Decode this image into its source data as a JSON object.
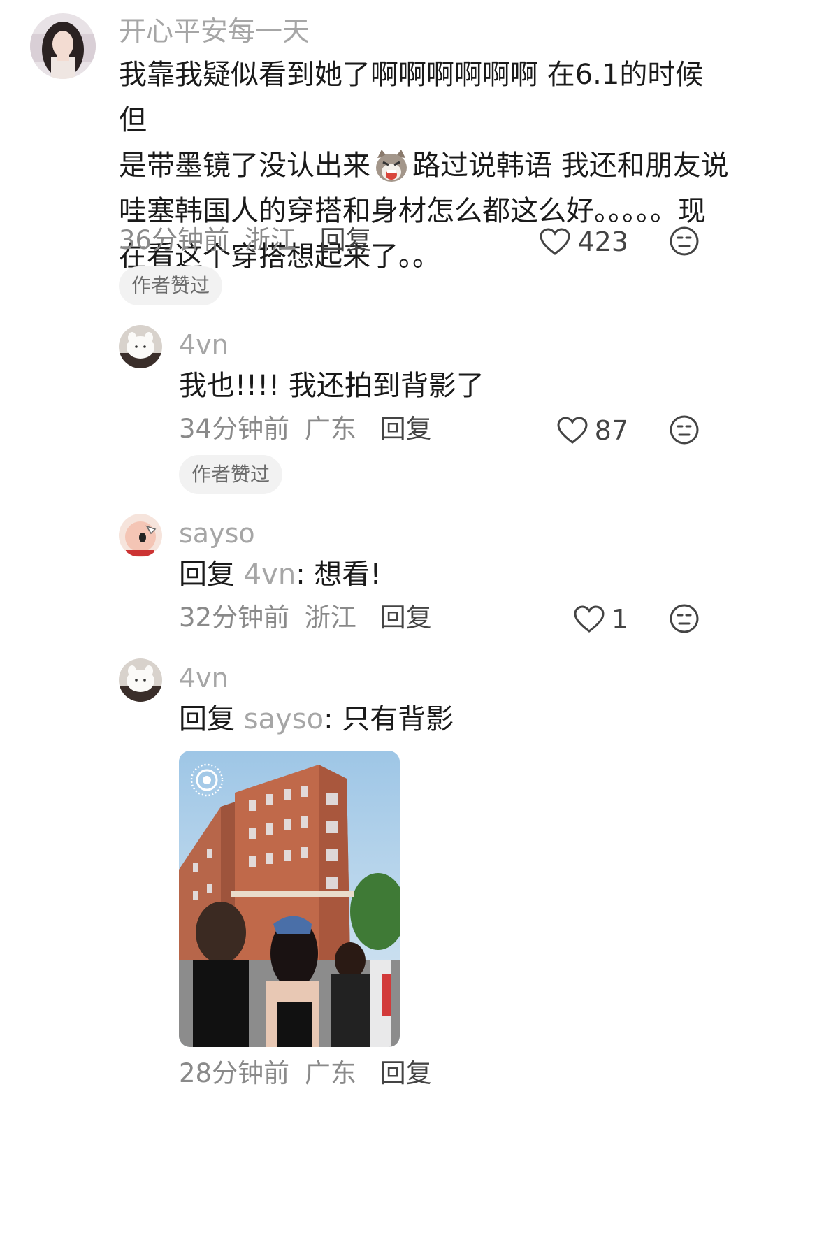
{
  "comments": [
    {
      "username": "开心平安每一天",
      "text_lines": [
        "我靠我疑似看到她了啊啊啊啊啊啊  在6.1的时候 但",
        "是带墨镜了没认出来",
        " 路过说韩语 我还和朋友说",
        "哇塞韩国人的穿搭和身材怎么都这么好。。。。。现",
        "在看这个穿搭想起来了。。"
      ],
      "time": "36分钟前",
      "location": "浙江",
      "reply_label": "回复",
      "likes": "423",
      "badge": "作者赞过"
    },
    {
      "username": "4vn",
      "text": "我也!!!!  我还拍到背影了",
      "time": "34分钟前",
      "location": "广东",
      "reply_label": "回复",
      "likes": "87",
      "badge": "作者赞过"
    },
    {
      "username": "sayso",
      "reply_prefix": "回复",
      "reply_to": "4vn",
      "text": ": 想看!",
      "time": "32分钟前",
      "location": "浙江",
      "reply_label": "回复",
      "likes": "1"
    },
    {
      "username": "4vn",
      "reply_prefix": "回复",
      "reply_to": "sayso",
      "text": ": 只有背影",
      "time": "28分钟前",
      "location": "广东",
      "reply_label": "回复"
    }
  ],
  "icons": {
    "like": "heart-icon",
    "dislike": "meh-face-icon",
    "sticker": "cat-emoji-icon",
    "live_photo": "live-photo-icon"
  },
  "colors": {
    "text": "#1a1a1a",
    "muted": "#8a8a8a",
    "username": "#a6a6a6",
    "badge_bg": "#f2f2f2"
  }
}
